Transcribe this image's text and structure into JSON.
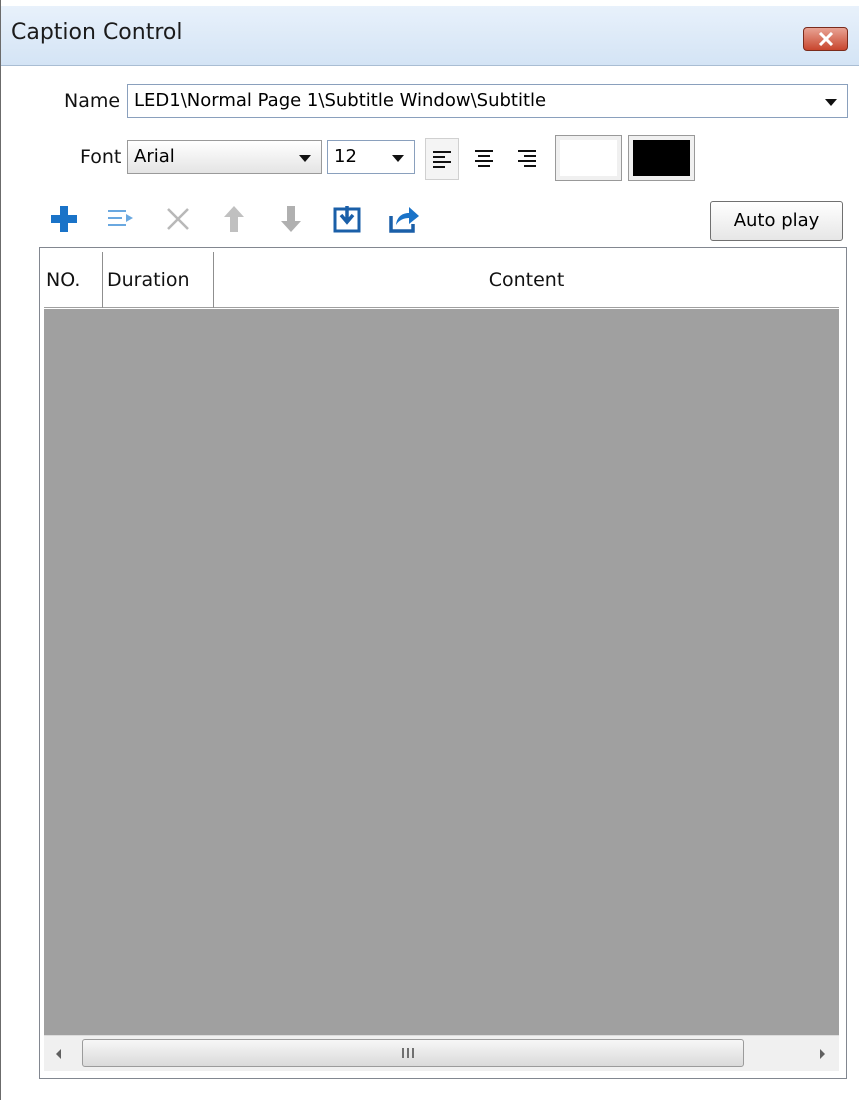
{
  "window": {
    "title": "Caption Control"
  },
  "name_field": {
    "label": "Name",
    "value": "LED1\\Normal Page 1\\Subtitle Window\\Subtitle"
  },
  "font_field": {
    "label": "Font",
    "family_value": "Arial",
    "size_value": "12"
  },
  "alignment": {
    "options": [
      "left",
      "center",
      "right"
    ],
    "selected": "left"
  },
  "colors": {
    "text_color": "#ffffff",
    "background_color": "#000000",
    "accent": "#1a73c8"
  },
  "toolbar": {
    "icons": [
      "add-icon",
      "insert-icon",
      "delete-icon",
      "move-up-icon",
      "move-down-icon",
      "import-icon",
      "export-icon"
    ],
    "autoplay_label": "Auto play"
  },
  "table": {
    "columns": [
      "NO.",
      "Duration",
      "Content"
    ],
    "rows": [],
    "scrollbar_grip": "III"
  }
}
